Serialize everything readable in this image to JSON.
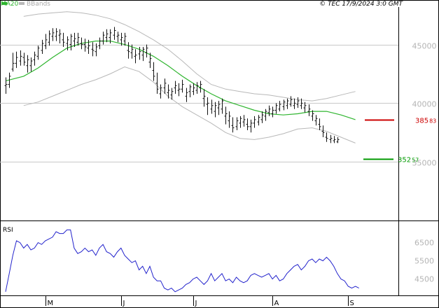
{
  "header": {
    "legend": [
      {
        "label": "MA20",
        "color": "#2fb52f"
      },
      {
        "label": "BBands",
        "color": "#b8b8b8"
      }
    ],
    "watermark": "© TEC 17/9/2024 3:0 GMT"
  },
  "colors": {
    "bars": "#111111",
    "ma": "#2fb52f",
    "bands": "#b8b8b8",
    "resistance": "#cc0000",
    "support": "#009900",
    "rsi": "#2222cc",
    "grid": "#c8c8c8"
  },
  "chart_data": [
    {
      "type": "ohlc",
      "name": "price",
      "ylim": [
        30000,
        48200
      ],
      "y_ticks": [
        35000,
        40000,
        45000
      ],
      "y_tick_labels": [
        "35000",
        "40000",
        "45000"
      ],
      "x_month_labels": [
        {
          "label": "M",
          "index": 11
        },
        {
          "label": "J",
          "index": 32
        },
        {
          "label": "J",
          "index": 52
        },
        {
          "label": "A",
          "index": 74
        },
        {
          "label": "S",
          "index": 95
        }
      ],
      "grid": true,
      "levels": [
        {
          "name": "resistance",
          "value": 38583,
          "label_main": "385",
          "label_small": "83"
        },
        {
          "name": "support",
          "value": 35257,
          "label_main": "352",
          "label_small": "57"
        }
      ],
      "bars": [
        [
          41500,
          42200,
          40800,
          41600
        ],
        [
          41600,
          42600,
          41300,
          42300
        ],
        [
          42900,
          44300,
          42700,
          43400
        ],
        [
          43400,
          44400,
          43000,
          43900
        ],
        [
          43600,
          44500,
          43200,
          44000
        ],
        [
          43900,
          44300,
          43200,
          43500
        ],
        [
          43200,
          44100,
          42600,
          43700
        ],
        [
          43200,
          43900,
          42700,
          43600
        ],
        [
          43700,
          44400,
          43200,
          44100
        ],
        [
          44000,
          44900,
          43700,
          44700
        ],
        [
          44500,
          45400,
          44200,
          45100
        ],
        [
          44900,
          45900,
          44600,
          45400
        ],
        [
          45200,
          46200,
          44900,
          45900
        ],
        [
          45700,
          46400,
          45300,
          46000
        ],
        [
          45700,
          46400,
          45300,
          46100
        ],
        [
          45800,
          46300,
          45100,
          45900
        ],
        [
          45400,
          46000,
          44800,
          45200
        ],
        [
          45100,
          45700,
          44500,
          45400
        ],
        [
          45000,
          45900,
          44500,
          45700
        ],
        [
          45300,
          46000,
          44800,
          45500
        ],
        [
          45200,
          46000,
          44900,
          45600
        ],
        [
          45100,
          45600,
          44600,
          45000
        ],
        [
          45000,
          45500,
          44400,
          44800
        ],
        [
          44700,
          45400,
          44200,
          44900
        ],
        [
          44600,
          45200,
          44000,
          44500
        ],
        [
          44400,
          45100,
          44000,
          44800
        ],
        [
          44900,
          45600,
          44600,
          45300
        ],
        [
          45300,
          46100,
          45000,
          45800
        ],
        [
          45600,
          46300,
          45200,
          45900
        ],
        [
          45600,
          46300,
          45100,
          46000
        ],
        [
          45800,
          46500,
          45400,
          46200
        ],
        [
          45700,
          46100,
          45200,
          45800
        ],
        [
          45400,
          46000,
          44900,
          45600
        ],
        [
          45300,
          46000,
          44900,
          45700
        ],
        [
          44500,
          45200,
          43800,
          44400
        ],
        [
          44300,
          45000,
          43800,
          44600
        ],
        [
          44000,
          44600,
          43400,
          44100
        ],
        [
          44200,
          44800,
          43700,
          44400
        ],
        [
          44100,
          44800,
          43600,
          44600
        ],
        [
          44300,
          45000,
          43900,
          44700
        ],
        [
          43500,
          44300,
          43000,
          43800
        ],
        [
          42800,
          43500,
          41900,
          42300
        ],
        [
          41700,
          42600,
          40800,
          41200
        ],
        [
          40800,
          41600,
          40400,
          41300
        ],
        [
          41300,
          42100,
          40800,
          41700
        ],
        [
          40900,
          41600,
          40400,
          41100
        ],
        [
          40700,
          41300,
          40300,
          41000
        ],
        [
          41300,
          41900,
          40800,
          41500
        ],
        [
          41100,
          41700,
          40600,
          41200
        ],
        [
          41200,
          42000,
          40900,
          41600
        ],
        [
          40600,
          41300,
          40100,
          40900
        ],
        [
          41000,
          41600,
          40500,
          41400
        ],
        [
          41000,
          41700,
          40700,
          41300
        ],
        [
          41100,
          41800,
          40800,
          41500
        ],
        [
          41300,
          41900,
          40900,
          41600
        ],
        [
          40400,
          41200,
          39700,
          40600
        ],
        [
          39900,
          40500,
          39000,
          40000
        ],
        [
          39500,
          40300,
          39100,
          39800
        ],
        [
          39300,
          40100,
          38800,
          39800
        ],
        [
          39600,
          40200,
          39000,
          39900
        ],
        [
          39500,
          40400,
          39100,
          40200
        ],
        [
          38900,
          39700,
          38200,
          39100
        ],
        [
          38500,
          39300,
          37900,
          38900
        ],
        [
          38100,
          38800,
          37500,
          37900
        ],
        [
          38000,
          38800,
          37700,
          38500
        ],
        [
          38300,
          38900,
          37900,
          38700
        ],
        [
          38400,
          39000,
          38000,
          38600
        ],
        [
          38200,
          38700,
          37700,
          38000
        ],
        [
          38000,
          38600,
          37500,
          38300
        ],
        [
          38300,
          38900,
          37900,
          38600
        ],
        [
          38400,
          39000,
          38100,
          38800
        ],
        [
          38600,
          39300,
          38300,
          39000
        ],
        [
          38900,
          39500,
          38500,
          39300
        ],
        [
          39200,
          39800,
          38900,
          39500
        ],
        [
          39100,
          39700,
          38800,
          39400
        ],
        [
          39400,
          40000,
          39100,
          39800
        ],
        [
          39500,
          40200,
          39300,
          39900
        ],
        [
          39700,
          40300,
          39400,
          40100
        ],
        [
          39800,
          40400,
          39500,
          40200
        ],
        [
          39900,
          40600,
          39700,
          40300
        ],
        [
          39800,
          40400,
          39500,
          40000
        ],
        [
          39900,
          40500,
          39600,
          40200
        ],
        [
          39800,
          40400,
          39500,
          40000
        ],
        [
          39600,
          40100,
          39200,
          39800
        ],
        [
          39300,
          39900,
          38900,
          39500
        ],
        [
          38900,
          39400,
          38500,
          39100
        ],
        [
          38500,
          39000,
          38100,
          38700
        ],
        [
          38200,
          38700,
          37700,
          38000
        ],
        [
          37600,
          38100,
          37100,
          37500
        ],
        [
          37100,
          37500,
          36700,
          37000
        ],
        [
          36900,
          37300,
          36600,
          37000
        ],
        [
          36800,
          37200,
          36600,
          36900
        ],
        [
          36700,
          37100,
          36600,
          36900
        ]
      ],
      "ma20": [
        [
          0,
          41900
        ],
        [
          5,
          42300
        ],
        [
          9,
          43000
        ],
        [
          13,
          43900
        ],
        [
          17,
          44700
        ],
        [
          21,
          45100
        ],
        [
          25,
          45300
        ],
        [
          29,
          45300
        ],
        [
          33,
          45000
        ],
        [
          37,
          44600
        ],
        [
          41,
          44000
        ],
        [
          45,
          43200
        ],
        [
          49,
          42300
        ],
        [
          53,
          41500
        ],
        [
          57,
          40800
        ],
        [
          61,
          40200
        ],
        [
          65,
          39800
        ],
        [
          69,
          39400
        ],
        [
          73,
          39100
        ],
        [
          77,
          39000
        ],
        [
          81,
          39100
        ],
        [
          85,
          39300
        ],
        [
          89,
          39300
        ],
        [
          93,
          39000
        ],
        [
          97,
          38600
        ]
      ],
      "bband_upper": [
        [
          5,
          47400
        ],
        [
          9,
          47600
        ],
        [
          13,
          47700
        ],
        [
          17,
          47800
        ],
        [
          21,
          47700
        ],
        [
          25,
          47500
        ],
        [
          29,
          47200
        ],
        [
          33,
          46700
        ],
        [
          37,
          46100
        ],
        [
          41,
          45400
        ],
        [
          45,
          44600
        ],
        [
          49,
          43600
        ],
        [
          53,
          42500
        ],
        [
          57,
          41600
        ],
        [
          61,
          41200
        ],
        [
          65,
          41000
        ],
        [
          69,
          40800
        ],
        [
          73,
          40700
        ],
        [
          77,
          40500
        ],
        [
          81,
          40300
        ],
        [
          85,
          40200
        ],
        [
          89,
          40400
        ],
        [
          93,
          40700
        ],
        [
          97,
          41000
        ]
      ],
      "bband_lower": [
        [
          5,
          39800
        ],
        [
          9,
          40100
        ],
        [
          13,
          40600
        ],
        [
          17,
          41100
        ],
        [
          21,
          41600
        ],
        [
          25,
          42000
        ],
        [
          29,
          42500
        ],
        [
          33,
          43100
        ],
        [
          37,
          42700
        ],
        [
          41,
          41800
        ],
        [
          45,
          40600
        ],
        [
          49,
          39700
        ],
        [
          53,
          39000
        ],
        [
          57,
          38300
        ],
        [
          61,
          37500
        ],
        [
          65,
          37000
        ],
        [
          69,
          36900
        ],
        [
          73,
          37100
        ],
        [
          77,
          37400
        ],
        [
          81,
          37800
        ],
        [
          85,
          37900
        ],
        [
          89,
          37600
        ],
        [
          93,
          37100
        ],
        [
          97,
          36600
        ]
      ]
    },
    {
      "type": "line",
      "name": "RSI",
      "title": "RSI",
      "y_ticks": [
        45,
        55,
        65
      ],
      "y_tick_labels": [
        "4500",
        "5500",
        "6500"
      ],
      "ylim": [
        36,
        76
      ],
      "values": [
        38,
        48,
        58,
        66,
        65,
        62,
        64,
        61,
        62,
        65,
        64,
        66,
        67,
        68,
        71,
        70,
        70,
        72,
        72,
        62,
        59,
        60,
        62,
        60,
        61,
        58,
        62,
        64,
        60,
        59,
        57,
        60,
        62,
        58,
        56,
        54,
        55,
        50,
        52,
        48,
        52,
        46,
        44,
        44,
        40,
        39,
        40,
        38,
        39,
        40,
        42,
        43,
        45,
        46,
        44,
        42,
        44,
        48,
        44,
        46,
        48,
        44,
        45,
        43,
        46,
        44,
        43,
        44,
        47,
        48,
        47,
        46,
        47,
        48,
        45,
        47,
        44,
        45,
        48,
        50,
        52,
        53,
        50,
        52,
        55,
        56,
        54,
        56,
        55,
        57,
        55,
        52,
        48,
        45,
        44,
        41,
        40,
        41,
        40
      ]
    }
  ]
}
